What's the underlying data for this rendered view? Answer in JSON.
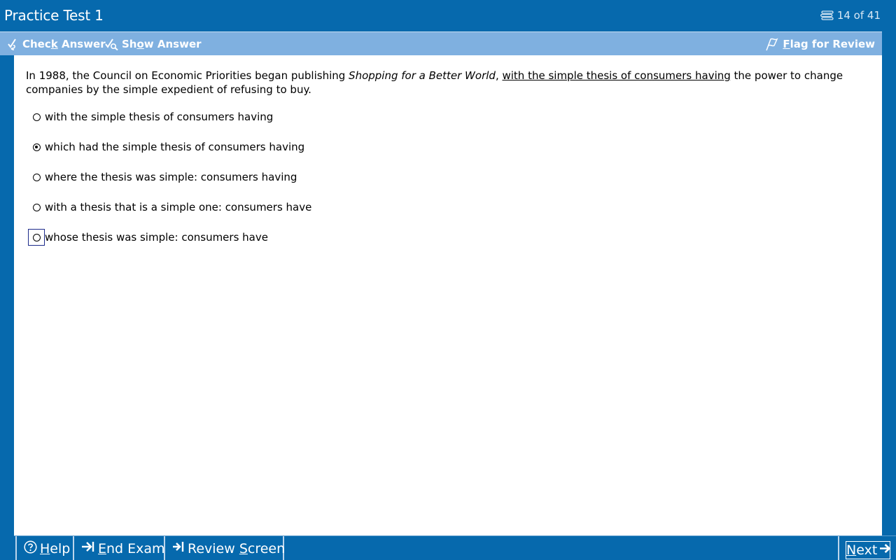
{
  "window": {
    "title": "Practice Test 1",
    "progress": "14 of 41"
  },
  "toolbar": {
    "check_answer": {
      "pre": "Chec",
      "key": "k",
      "post": " Answer"
    },
    "show_answer": {
      "pre": "Sh",
      "key": "o",
      "post": "w Answer"
    },
    "flag_review": {
      "key": "F",
      "post": "lag for Review"
    }
  },
  "question": {
    "text_before": "In 1988, the Council on Economic Priorities began publishing ",
    "italic": "Shopping for a Better World",
    "comma": ", ",
    "underlined": "with the simple thesis of consumers having",
    "text_after": " the power to change companies by the simple expedient of refusing to buy."
  },
  "options": [
    {
      "label": "with the simple thesis of consumers having",
      "selected": false
    },
    {
      "label": "which had the simple thesis of consumers having",
      "selected": true
    },
    {
      "label": "where the thesis was simple:  consumers having",
      "selected": false
    },
    {
      "label": "with a thesis that is a simple one:  consumers have",
      "selected": false
    },
    {
      "label": "whose thesis was simple:  consumers have",
      "selected": false,
      "focused": true
    }
  ],
  "bottombar": {
    "help": {
      "key": "H",
      "post": "elp"
    },
    "end_exam": {
      "key": "E",
      "post": "nd Exam"
    },
    "review_screen": {
      "pre": "Review ",
      "key": "S",
      "post": "creen"
    },
    "next": {
      "key": "N",
      "post": "ext"
    }
  }
}
